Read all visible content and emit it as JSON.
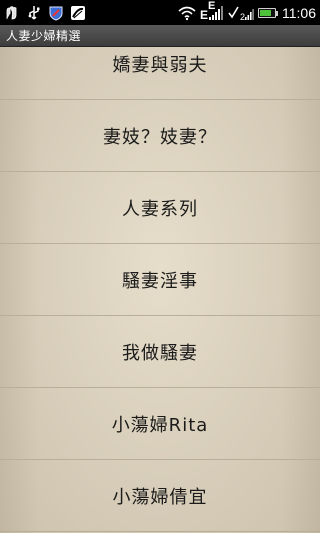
{
  "status_bar": {
    "time": "11:06",
    "network_label": "E",
    "battery_level_percent": 80,
    "icons": [
      "hands-icon",
      "usb-icon",
      "shield-icon",
      "no-sim-icon",
      "wifi-icon",
      "h-signal-icon",
      "e-signal-icon",
      "battery-icon"
    ]
  },
  "app": {
    "title": "人妻少婦精選"
  },
  "list": {
    "items": [
      {
        "label": "嬌妻與弱夫"
      },
      {
        "label": "妻妓？妓妻？"
      },
      {
        "label": "人妻系列"
      },
      {
        "label": "騷妻淫事"
      },
      {
        "label": "我做騷妻"
      },
      {
        "label": "小蕩婦Rita"
      },
      {
        "label": "小蕩婦倩宜"
      }
    ]
  },
  "colors": {
    "background": "#e6ddca",
    "divider": "#b9ae99",
    "title_bar": "#4a4a4a",
    "battery_fill": "#4fc23c"
  }
}
